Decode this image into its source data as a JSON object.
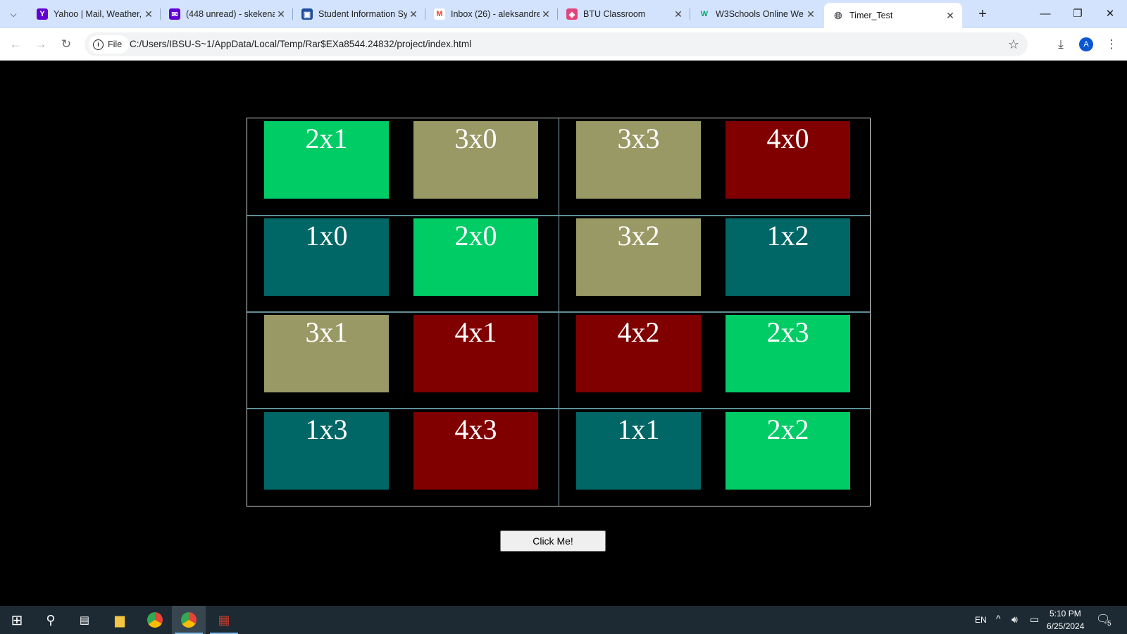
{
  "browser": {
    "tabs": [
      {
        "title": "Yahoo | Mail, Weather,",
        "icon": "yahoo-icon",
        "color": "#6001d2"
      },
      {
        "title": "(448 unread) - skekena",
        "icon": "yahoo-mail-icon",
        "color": "#6001d2"
      },
      {
        "title": "Student Information Sy",
        "icon": "sis-icon",
        "color": "#1f4e9c"
      },
      {
        "title": "Inbox (26) - aleksandre",
        "icon": "gmail-icon",
        "color": "#ea4335"
      },
      {
        "title": "BTU Classroom",
        "icon": "btu-icon",
        "color": "#e0457b"
      },
      {
        "title": "W3Schools Online We",
        "icon": "w3schools-icon",
        "color": "#04aa6d"
      },
      {
        "title": "Timer_Test",
        "icon": "globe-icon",
        "color": "#5f6368"
      }
    ],
    "chip_label": "File",
    "url": "C:/Users/IBSU-S~1/AppData/Local/Temp/Rar$EXa8544.24832/project/index.html",
    "avatar_letter": "A"
  },
  "page": {
    "cards": [
      {
        "label": "2x1",
        "color": "#00cc66"
      },
      {
        "label": "3x0",
        "color": "#999966"
      },
      {
        "label": "3x3",
        "color": "#999966"
      },
      {
        "label": "4x0",
        "color": "#800000"
      },
      {
        "label": "1x0",
        "color": "#006666"
      },
      {
        "label": "2x0",
        "color": "#00cc66"
      },
      {
        "label": "3x2",
        "color": "#999966"
      },
      {
        "label": "1x2",
        "color": "#006666"
      },
      {
        "label": "3x1",
        "color": "#999966"
      },
      {
        "label": "4x1",
        "color": "#800000"
      },
      {
        "label": "4x2",
        "color": "#800000"
      },
      {
        "label": "2x3",
        "color": "#00cc66"
      },
      {
        "label": "1x3",
        "color": "#006666"
      },
      {
        "label": "4x3",
        "color": "#800000"
      },
      {
        "label": "1x1",
        "color": "#006666"
      },
      {
        "label": "2x2",
        "color": "#00cc66"
      }
    ],
    "button_label": "Click Me!"
  },
  "taskbar": {
    "language": "EN",
    "time": "5:10 PM",
    "date": "6/25/2024",
    "notification_count": "5"
  }
}
